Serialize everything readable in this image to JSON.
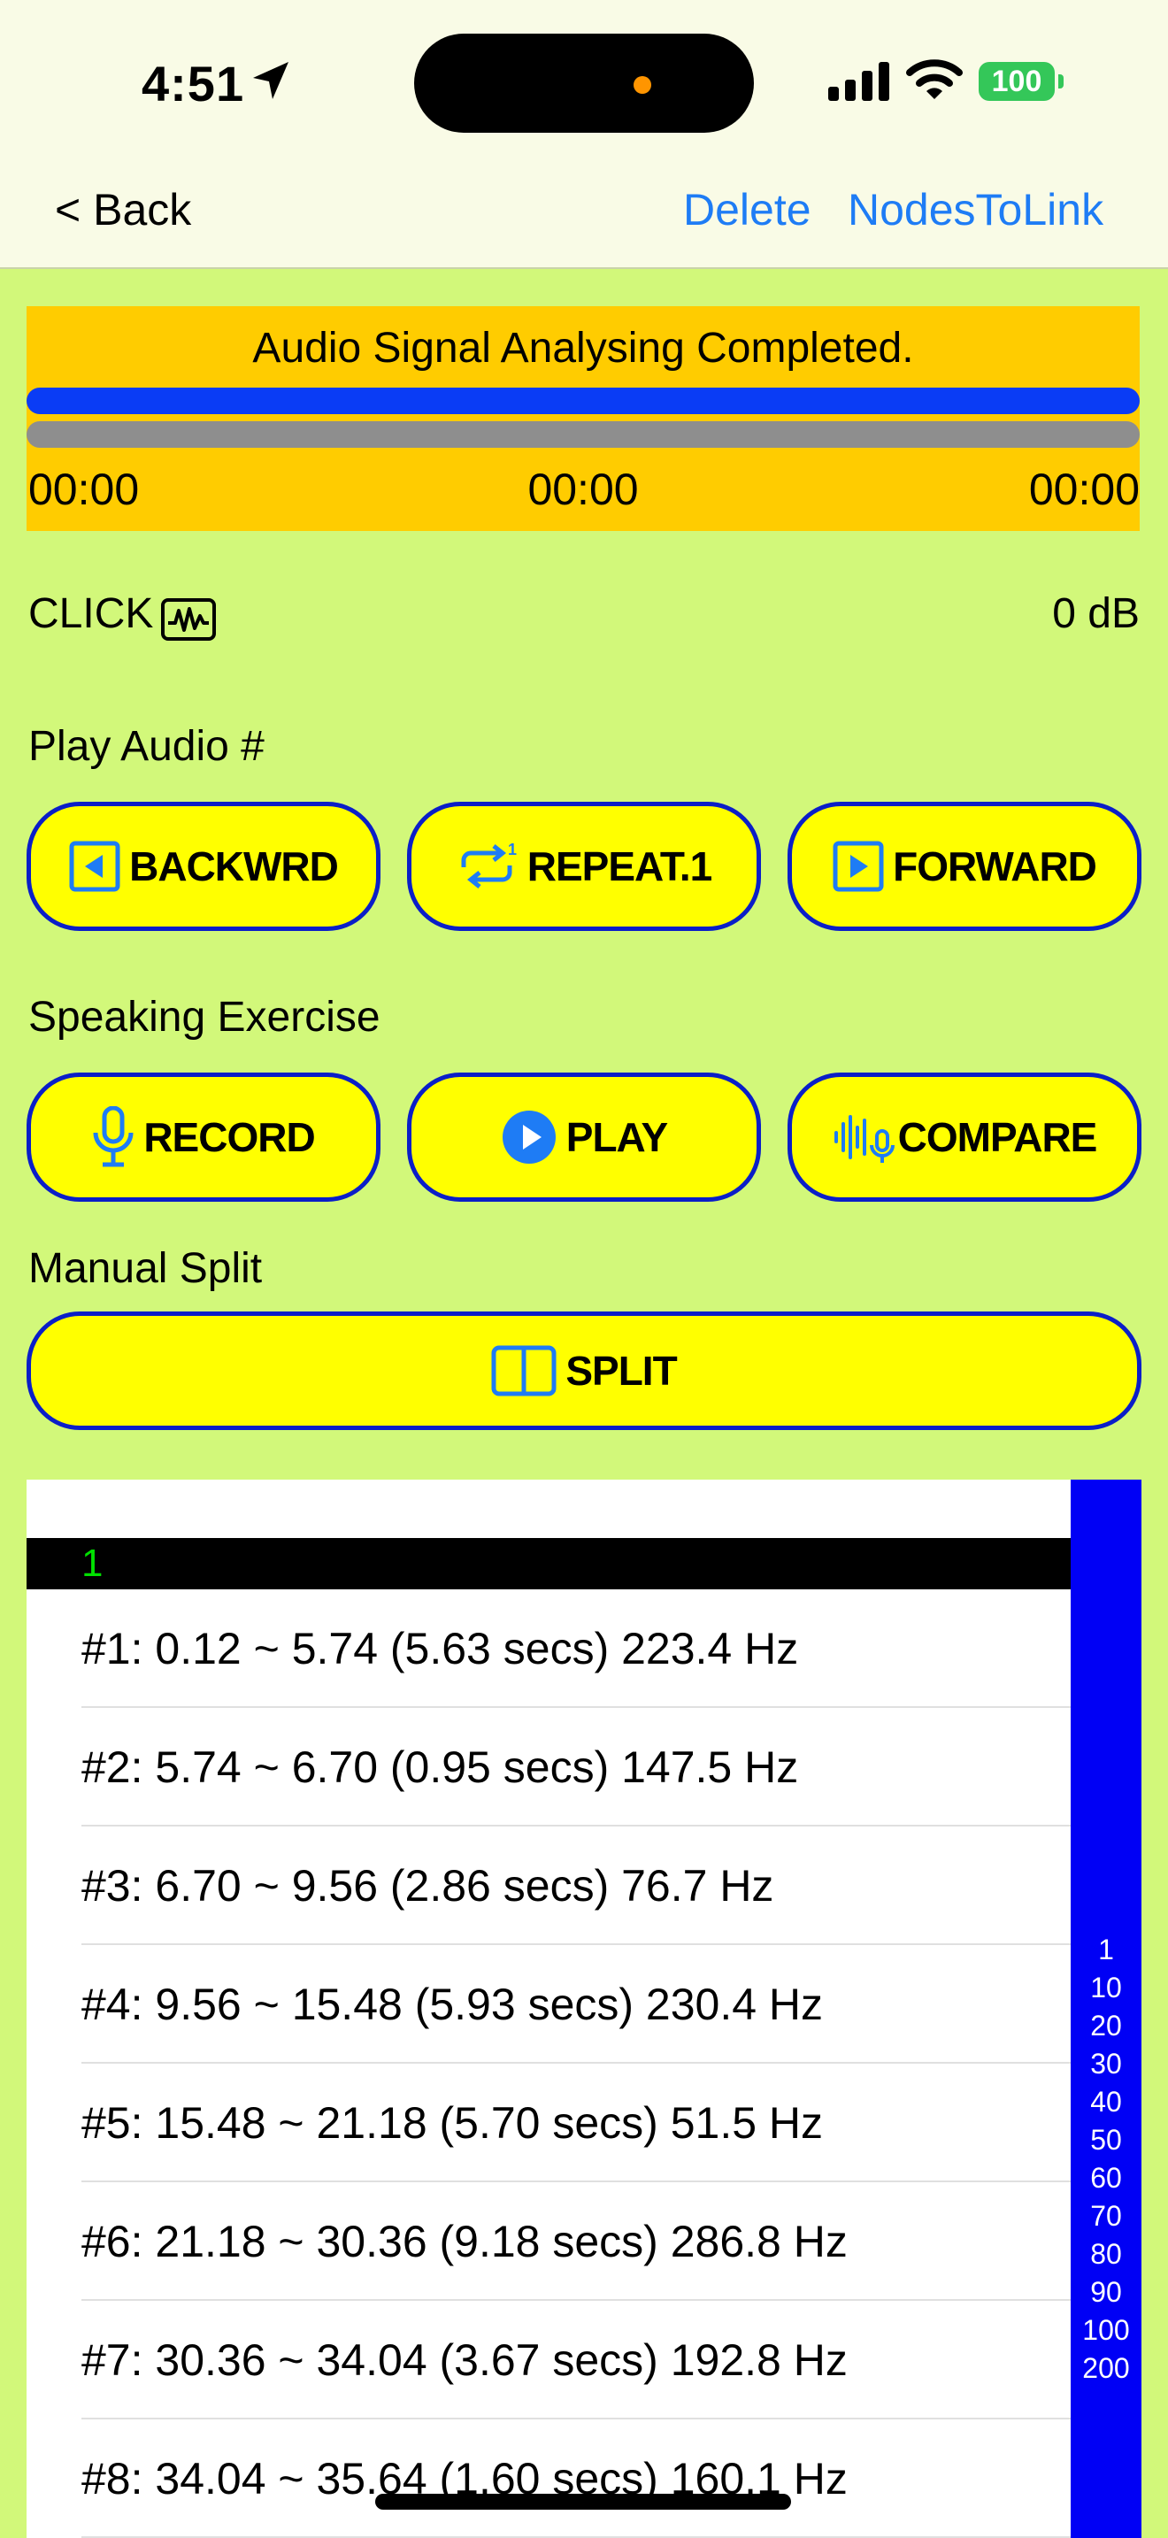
{
  "status_bar": {
    "time": "4:51",
    "battery": "100"
  },
  "nav": {
    "back_label": "< Back",
    "delete_label": "Delete",
    "nodes_label": "NodesToLink"
  },
  "progress": {
    "message": "Audio Signal Analysing Completed.",
    "time_left": "00:00",
    "time_center": "00:00",
    "time_right": "00:00"
  },
  "click": {
    "label": "CLICK",
    "db": "0 dB"
  },
  "play_audio": {
    "label": "Play Audio #",
    "backward": "BACKWRD",
    "repeat": "REPEAT.1",
    "forward": "FORWARD"
  },
  "speaking": {
    "label": "Speaking Exercise",
    "record": "RECORD",
    "play": "PLAY",
    "compare": "COMPARE"
  },
  "manual_split": {
    "label": "Manual Split",
    "split": "SPLIT"
  },
  "list": {
    "section": "1",
    "rows": [
      "#1: 0.12 ~ 5.74 (5.63 secs) 223.4 Hz",
      "#2: 5.74 ~ 6.70 (0.95 secs) 147.5 Hz",
      "#3: 6.70 ~ 9.56 (2.86 secs) 76.7 Hz",
      "#4: 9.56 ~ 15.48 (5.93 secs) 230.4 Hz",
      "#5: 15.48 ~ 21.18 (5.70 secs) 51.5 Hz",
      "#6: 21.18 ~ 30.36 (9.18 secs) 286.8 Hz",
      "#7: 30.36 ~ 34.04 (3.67 secs) 192.8 Hz",
      "#8: 34.04 ~ 35.64 (1.60 secs) 160.1 Hz"
    ]
  },
  "index": [
    "1",
    "10",
    "20",
    "30",
    "40",
    "50",
    "60",
    "70",
    "80",
    "90",
    "100",
    "200"
  ],
  "colors": {
    "background": "#d2f87a",
    "button": "#ffff00",
    "accent": "#1e7cf5",
    "panel": "#ffcc00"
  },
  "icons": [
    "location-arrow-icon",
    "signal-icon",
    "wifi-icon",
    "waveform-icon",
    "backward-icon",
    "repeat-one-icon",
    "forward-icon",
    "mic-icon",
    "play-circle-icon",
    "compare-icon",
    "split-icon"
  ]
}
